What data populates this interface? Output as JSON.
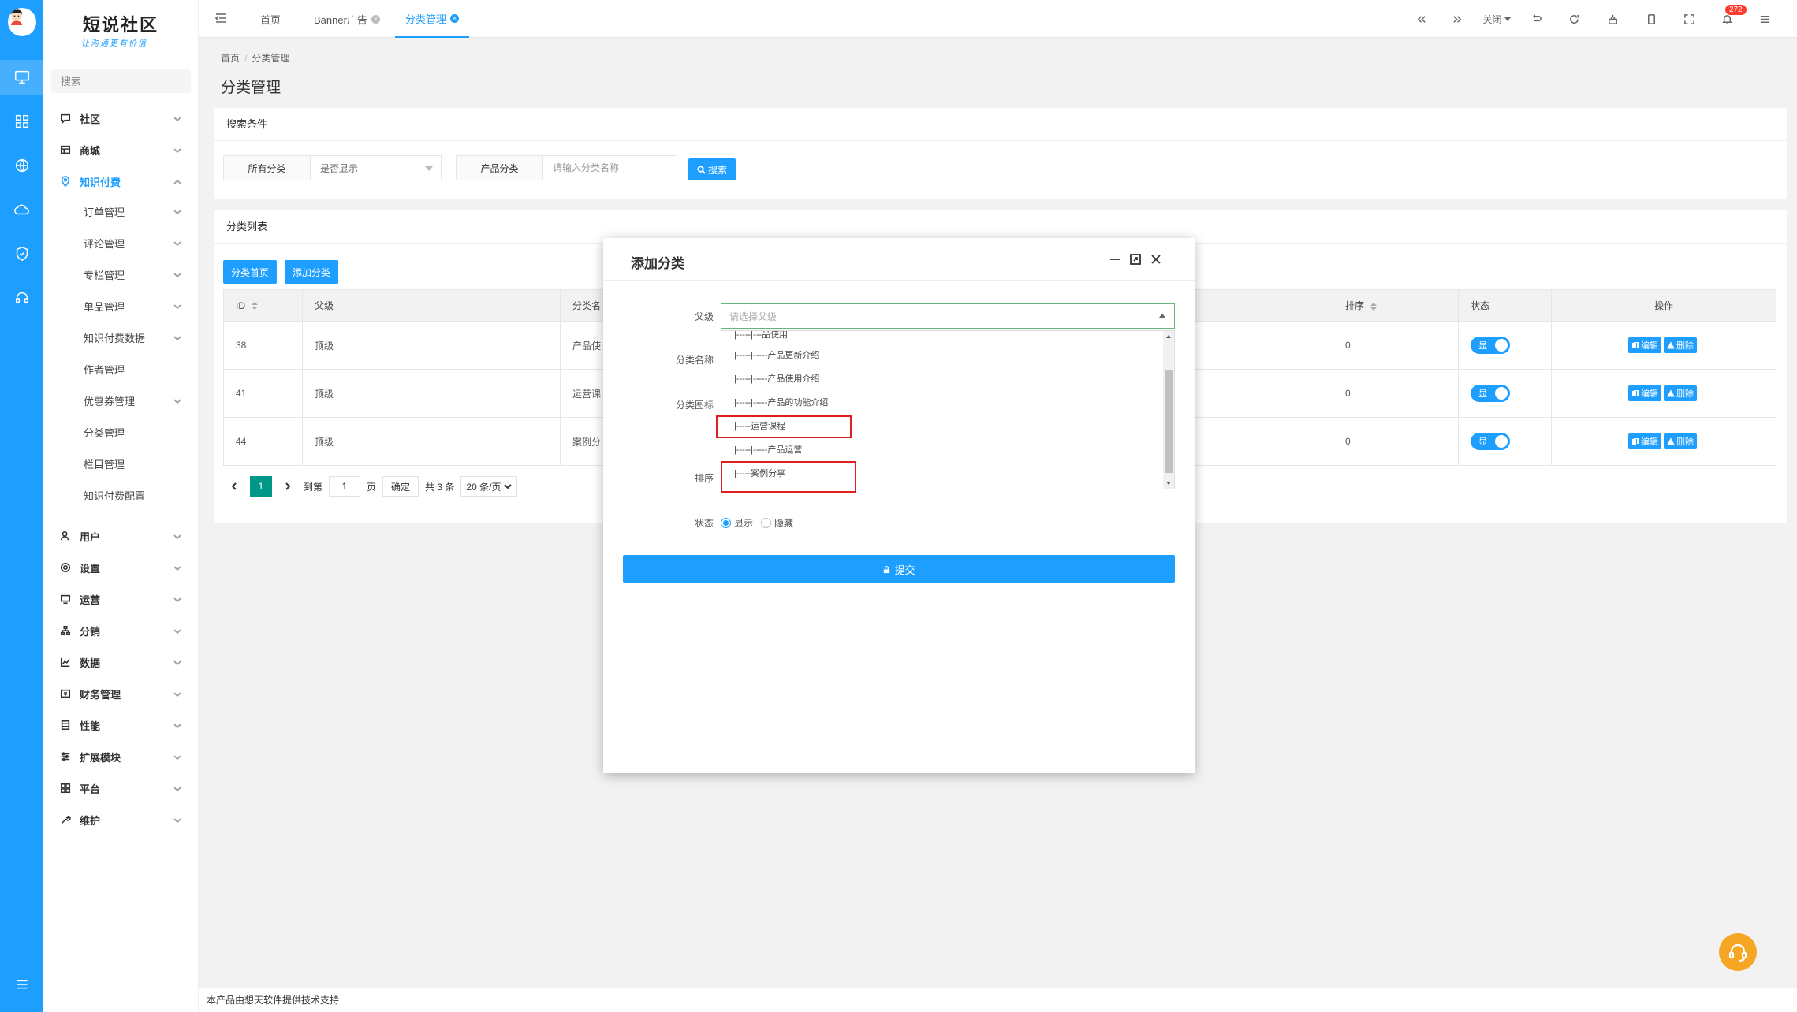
{
  "sidebar": {
    "logo_title": "短说社区",
    "logo_subtitle": "让沟通更有价值",
    "search_placeholder": "搜索",
    "menu": [
      {
        "label": "社区"
      },
      {
        "label": "商城"
      },
      {
        "label": "知识付费"
      }
    ],
    "sub_menu": [
      {
        "label": "订单管理",
        "has_children": true
      },
      {
        "label": "评论管理",
        "has_children": true
      },
      {
        "label": "专栏管理",
        "has_children": true
      },
      {
        "label": "单品管理",
        "has_children": true
      },
      {
        "label": "知识付费数据",
        "has_children": true
      },
      {
        "label": "作者管理",
        "has_children": false
      },
      {
        "label": "优惠券管理",
        "has_children": true
      },
      {
        "label": "分类管理",
        "has_children": false
      },
      {
        "label": "栏目管理",
        "has_children": false
      },
      {
        "label": "知识付费配置",
        "has_children": false
      }
    ],
    "menu_bottom": [
      {
        "label": "用户"
      },
      {
        "label": "设置"
      },
      {
        "label": "运营"
      },
      {
        "label": "分销"
      },
      {
        "label": "数据"
      },
      {
        "label": "财务管理"
      },
      {
        "label": "性能"
      },
      {
        "label": "扩展模块"
      },
      {
        "label": "平台"
      },
      {
        "label": "维护"
      }
    ]
  },
  "topbar": {
    "tabs": [
      {
        "label": "首页"
      },
      {
        "label": "Banner广告"
      },
      {
        "label": "分类管理"
      }
    ],
    "close_label": "关闭",
    "notification_count": "272"
  },
  "breadcrumb": {
    "home": "首页",
    "current": "分类管理"
  },
  "page_title": "分类管理",
  "search_card": {
    "title": "搜索条件",
    "field1_label": "所有分类",
    "field1_value": "是否显示",
    "field2_label": "产品分类",
    "field2_placeholder": "请输入分类名称",
    "search_button": "搜索"
  },
  "list_card": {
    "title": "分类列表",
    "btn_home": "分类首页",
    "btn_add": "添加分类",
    "columns": {
      "id": "ID",
      "parent": "父级",
      "name": "分类名",
      "sort": "排序",
      "status": "状态",
      "ops": "操作"
    },
    "rows": [
      {
        "id": "38",
        "parent": "顶级",
        "name": "产品使",
        "sort": "0",
        "status": "显"
      },
      {
        "id": "41",
        "parent": "顶级",
        "name": "运营课",
        "sort": "0",
        "status": "显"
      },
      {
        "id": "44",
        "parent": "顶级",
        "name": "案例分",
        "sort": "0",
        "status": "显"
      }
    ],
    "edit_label": "编辑",
    "delete_label": "删除"
  },
  "pager": {
    "current": "1",
    "goto_label": "到第",
    "goto_value": "1",
    "page_label": "页",
    "confirm": "确定",
    "total": "共 3 条",
    "page_size": "20 条/页"
  },
  "modal": {
    "title": "添加分类",
    "parent_label": "父级",
    "parent_placeholder": "请选择父级",
    "options": [
      "|-----|---品使用",
      "|-----|-----产品更新介绍",
      "|-----|-----产品使用介绍",
      "|-----|-----产品的功能介绍",
      "|-----运营课程",
      "|-----|-----产品运营",
      "|-----案例分享"
    ],
    "name_label": "分类名称",
    "icon_label": "分类图标",
    "sort_label": "排序",
    "status_label": "状态",
    "status_show": "显示",
    "status_hide": "隐藏",
    "submit": "提交"
  },
  "footer": "本产品由想天软件提供技术支持"
}
